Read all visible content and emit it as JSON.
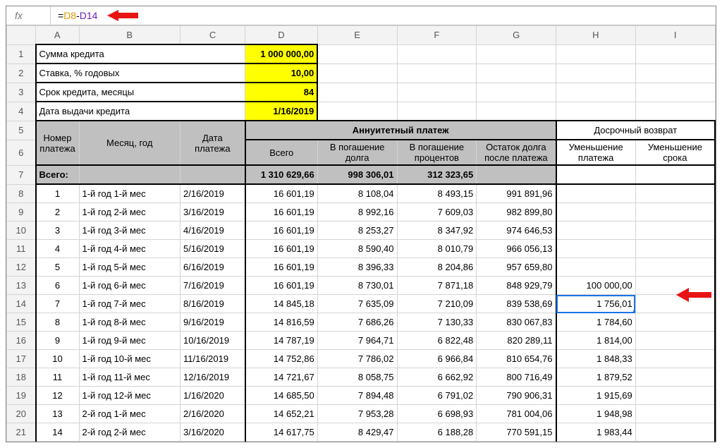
{
  "formula_bar": {
    "fx": "fx",
    "eq": "=",
    "ref1": "D8",
    "minus": "-",
    "ref2": "D14"
  },
  "columns": [
    "A",
    "B",
    "C",
    "D",
    "E",
    "F",
    "G",
    "H",
    "I"
  ],
  "labels": {
    "r1": "Сумма кредита",
    "r2": "Ставка, % годовых",
    "r3": "Срок кредита, месяцы",
    "r4": "Дата выдачи кредита"
  },
  "inputs": {
    "r1": "1 000 000,00",
    "r2": "10,00",
    "r3": "84",
    "r4": "1/16/2019"
  },
  "header": {
    "col_a": "Номер платежа",
    "col_b": "Месяц, год",
    "col_c": "Дата платежа",
    "span_defg": "Аннуитетный платеж",
    "col_d": "Всего",
    "col_e": "В погашение долга",
    "col_f": "В погашение процентов",
    "col_g": "Остаток долга после платежа",
    "span_hi": "Досрочный возврат",
    "col_h": "Уменьшение платежа",
    "col_i": "Уменьшение срока"
  },
  "totals": {
    "label": "Всего:",
    "d": "1 310 629,66",
    "e": "998 306,01",
    "f": "312 323,65"
  },
  "rows": [
    {
      "rn": "8",
      "n": "1",
      "month": "1-й год 1-й мес",
      "date": "2/16/2019",
      "d": "16 601,19",
      "e": "8 108,04",
      "f": "8 493,15",
      "g": "991 891,96",
      "h": "",
      "i": ""
    },
    {
      "rn": "9",
      "n": "2",
      "month": "1-й год 2-й мес",
      "date": "3/16/2019",
      "d": "16 601,19",
      "e": "8 992,16",
      "f": "7 609,03",
      "g": "982 899,80",
      "h": "",
      "i": ""
    },
    {
      "rn": "10",
      "n": "3",
      "month": "1-й год 3-й мес",
      "date": "4/16/2019",
      "d": "16 601,19",
      "e": "8 253,27",
      "f": "8 347,92",
      "g": "974 646,53",
      "h": "",
      "i": ""
    },
    {
      "rn": "11",
      "n": "4",
      "month": "1-й год 4-й мес",
      "date": "5/16/2019",
      "d": "16 601,19",
      "e": "8 590,40",
      "f": "8 010,79",
      "g": "966 056,13",
      "h": "",
      "i": ""
    },
    {
      "rn": "12",
      "n": "5",
      "month": "1-й год 5-й мес",
      "date": "6/16/2019",
      "d": "16 601,19",
      "e": "8 396,33",
      "f": "8 204,86",
      "g": "957 659,80",
      "h": "",
      "i": ""
    },
    {
      "rn": "13",
      "n": "6",
      "month": "1-й год 6-й мес",
      "date": "7/16/2019",
      "d": "16 601,19",
      "e": "8 730,01",
      "f": "7 871,18",
      "g": "848 929,79",
      "h": "100 000,00",
      "i": ""
    },
    {
      "rn": "14",
      "n": "7",
      "month": "1-й год 7-й мес",
      "date": "8/16/2019",
      "d": "14 845,18",
      "e": "7 635,09",
      "f": "7 210,09",
      "g": "839 538,69",
      "h": "1 756,01",
      "i": ""
    },
    {
      "rn": "15",
      "n": "8",
      "month": "1-й год 8-й мес",
      "date": "9/16/2019",
      "d": "14 816,59",
      "e": "7 686,26",
      "f": "7 130,33",
      "g": "830 067,83",
      "h": "1 784,60",
      "i": ""
    },
    {
      "rn": "16",
      "n": "9",
      "month": "1-й год 9-й мес",
      "date": "10/16/2019",
      "d": "14 787,19",
      "e": "7 964,71",
      "f": "6 822,48",
      "g": "820 289,11",
      "h": "1 814,00",
      "i": ""
    },
    {
      "rn": "17",
      "n": "10",
      "month": "1-й год 10-й мес",
      "date": "11/16/2019",
      "d": "14 752,86",
      "e": "7 786,02",
      "f": "6 966,84",
      "g": "810 654,76",
      "h": "1 848,33",
      "i": ""
    },
    {
      "rn": "18",
      "n": "11",
      "month": "1-й год 11-й мес",
      "date": "12/16/2019",
      "d": "14 721,67",
      "e": "8 058,75",
      "f": "6 662,92",
      "g": "800 716,49",
      "h": "1 879,52",
      "i": ""
    },
    {
      "rn": "19",
      "n": "12",
      "month": "1-й год 12-й мес",
      "date": "1/16/2020",
      "d": "14 685,50",
      "e": "7 894,48",
      "f": "6 791,02",
      "g": "790 906,31",
      "h": "1 915,69",
      "i": ""
    },
    {
      "rn": "20",
      "n": "13",
      "month": "2-й год 1-й мес",
      "date": "2/16/2020",
      "d": "14 652,21",
      "e": "7 953,28",
      "f": "6 698,93",
      "g": "781 004,06",
      "h": "1 948,98",
      "i": ""
    },
    {
      "rn": "21",
      "n": "14",
      "month": "2-й год 2-й мес",
      "date": "3/16/2020",
      "d": "14 617,75",
      "e": "8 429,47",
      "f": "6 188,28",
      "g": "770 591,15",
      "h": "1 983,44",
      "i": ""
    }
  ],
  "active_cell": {
    "row_index": 6
  }
}
